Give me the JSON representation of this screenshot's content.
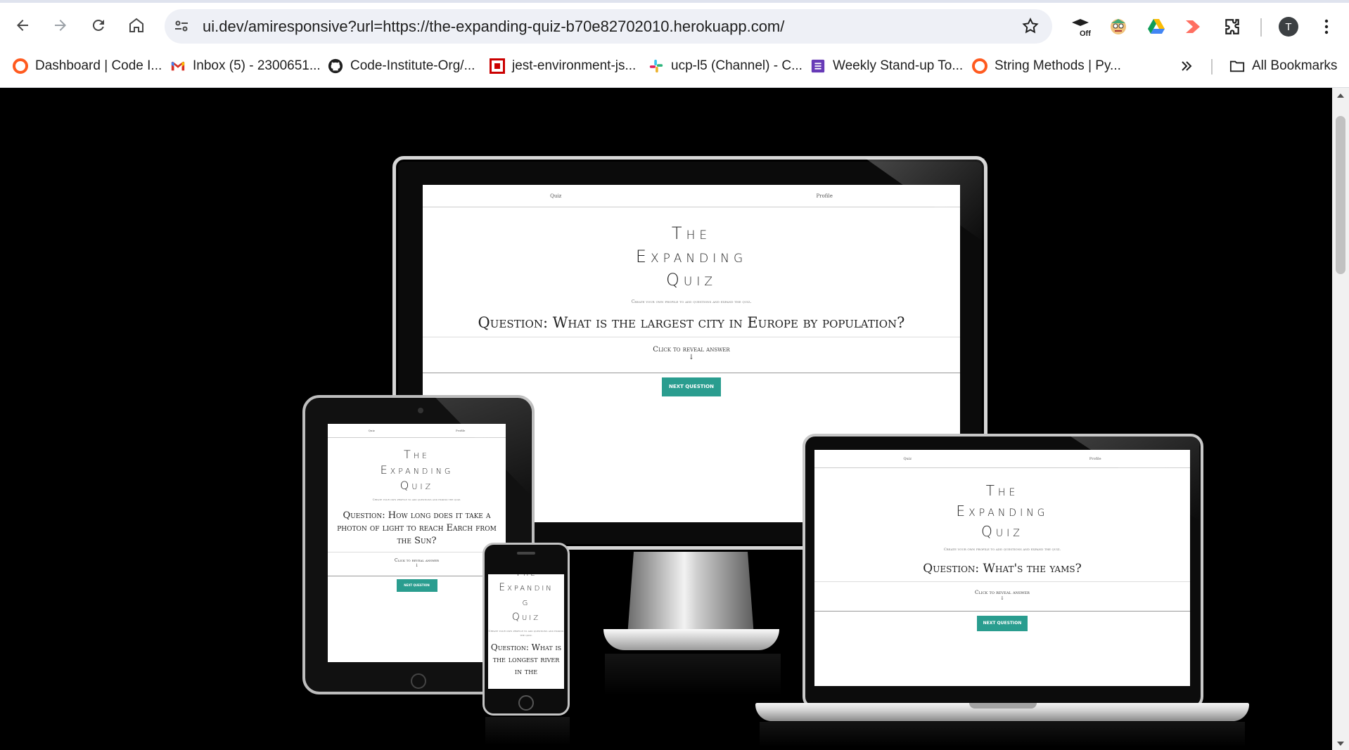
{
  "browser": {
    "url": "ui.dev/amiresponsive?url=https://the-expanding-quiz-b70e82702010.herokuapp.com/",
    "profile_initial": "T",
    "extension_off_label": "Off",
    "bookmarks": [
      {
        "label": "Dashboard | Code I...",
        "icon": "codeinstitute-icon",
        "color": "#ff5a1f"
      },
      {
        "label": "Inbox (5) - 2300651...",
        "icon": "gmail-icon",
        "color": "#d93025"
      },
      {
        "label": "Code-Institute-Org/...",
        "icon": "github-icon",
        "color": "#1f1f1f"
      },
      {
        "label": "jest-environment-js...",
        "icon": "npm-icon",
        "color": "#cb0000"
      },
      {
        "label": "ucp-l5 (Channel) - C...",
        "icon": "slack-icon",
        "color": "#e01e5a"
      },
      {
        "label": "Weekly Stand-up To...",
        "icon": "forms-icon",
        "color": "#673ab7"
      },
      {
        "label": "String Methods | Py...",
        "icon": "codeinstitute-icon",
        "color": "#ff5a1f"
      }
    ],
    "all_bookmarks": "All Bookmarks"
  },
  "site": {
    "nav_quiz": "Quiz",
    "nav_profile": "Profile",
    "title_line1": "The",
    "title_line2": "Expanding",
    "title_line3": "Quiz",
    "subtitle": "Create your own profile to add questions and expand the quiz.",
    "reveal": "Click to reveal answer",
    "arrow": "↓",
    "next_button": "Next question"
  },
  "devices": {
    "monitor": {
      "question": "Question: What is the largest city in Europe by population?"
    },
    "tablet": {
      "question": "Question: How long does it take a photon of light to reach Earch from the Sun?"
    },
    "phone": {
      "title_partial_1": "The",
      "title_partial_2": "Expandin",
      "title_partial_3": "g",
      "title_partial_4": "Quiz",
      "question": "Question: What is the longest river in the"
    },
    "laptop": {
      "question": "Question: What's the yams?"
    }
  },
  "colors": {
    "accent": "#2a9d8f",
    "background": "#000000"
  }
}
